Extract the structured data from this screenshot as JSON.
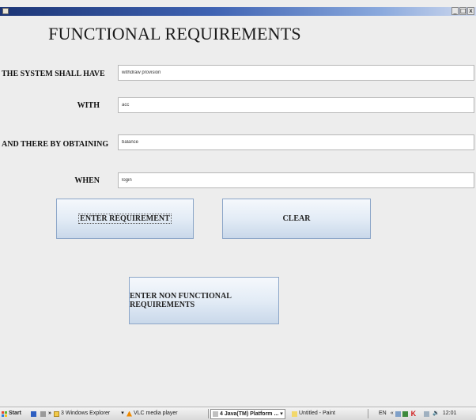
{
  "window": {
    "minimize": "_",
    "maximize": "□",
    "close": "x"
  },
  "form": {
    "heading": "FUNCTIONAL REQUIREMENTS",
    "system_label": "THE SYSTEM SHALL HAVE",
    "system_value": "withdraw provision",
    "with_label": "WITH",
    "with_value": "acc",
    "obtaining_label": "AND THERE BY OBTAINING",
    "obtaining_value": "balance",
    "when_label": "WHEN",
    "when_value": "login"
  },
  "buttons": {
    "enter_requirement": "ENTER REQUIREMENT",
    "clear": "CLEAR",
    "enter_non_functional": "ENTER NON FUNCTIONAL REQUIREMENTS"
  },
  "taskbar": {
    "start": "Start",
    "chevron": "»",
    "explorer": "3 Windows Explorer",
    "vlc": "VLC media player",
    "java": "4 Java(TM) Platform ...",
    "paint": "Untitled - Paint",
    "language": "EN",
    "tray_arrow": "«",
    "clock": "12:01"
  },
  "colors": {
    "titlebar": "#1c3576",
    "button_gradient_top": "#f5f8fc",
    "button_gradient_bottom": "#c9d8ea",
    "background": "#ededed"
  },
  "icons": [
    "app-icon",
    "start-icon",
    "quicklaunch-icon",
    "folder-icon",
    "vlc-icon",
    "java-icon",
    "paint-icon",
    "kaspersky-icon",
    "volume-icon"
  ]
}
